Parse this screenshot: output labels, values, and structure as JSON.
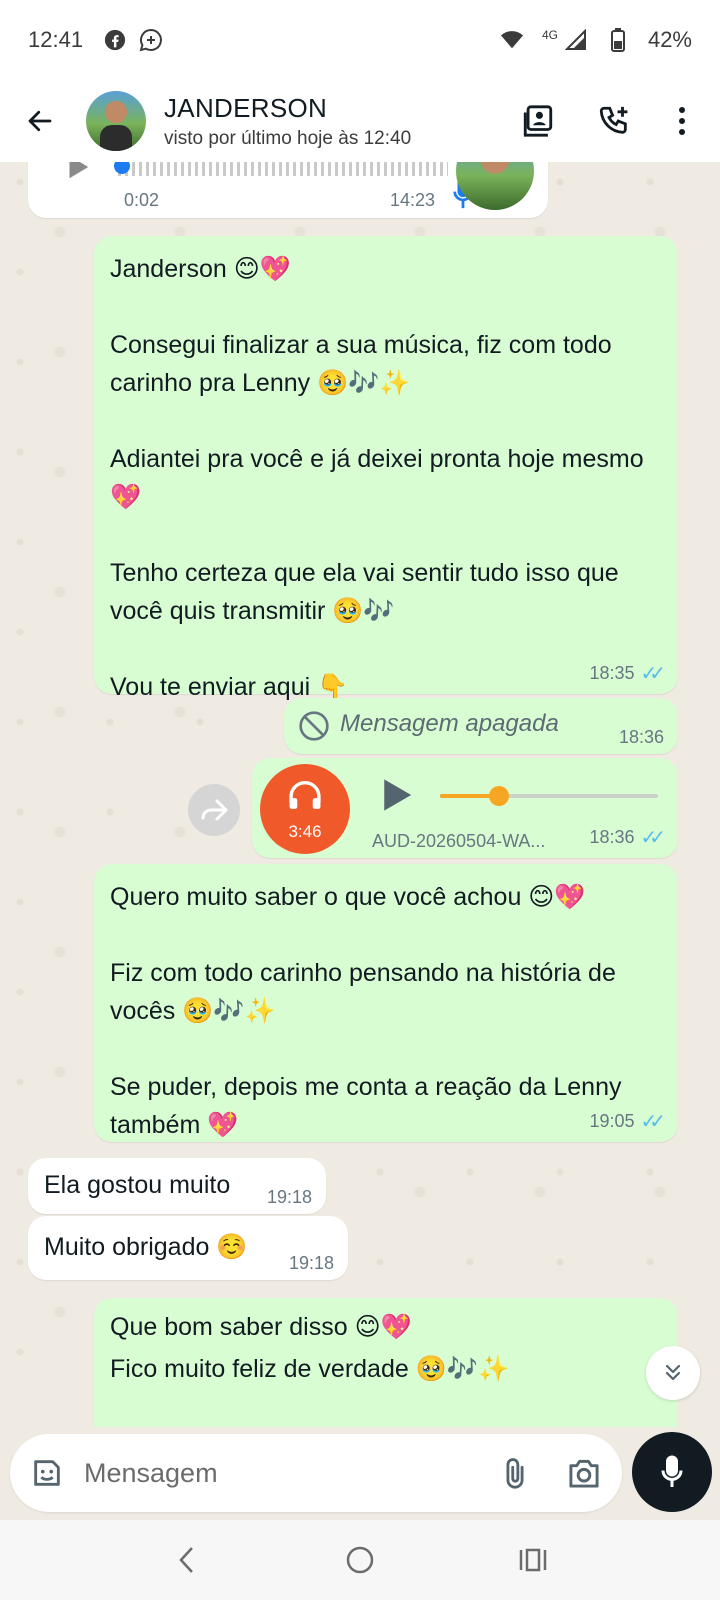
{
  "status_bar": {
    "time": "12:41",
    "network": "4G",
    "battery": "42%"
  },
  "header": {
    "contact_name": "JANDERSON",
    "status": "visto por último hoje às 12:40"
  },
  "messages": {
    "voice_prev": {
      "elapsed": "0:02",
      "time": "14:23"
    },
    "m1": {
      "text": "Janderson 😊💖\n\nConsegui finalizar a sua música, fiz com todo carinho pra Lenny 🥹🎶✨\n\nAdiantei pra você e já deixei pronta hoje mesmo 💖\n\nTenho certeza que ela vai sentir tudo isso que você quis transmitir 🥹🎶\n\nVou te enviar aqui 👇",
      "time": "18:35"
    },
    "deleted": {
      "text": "Mensagem apagada",
      "time": "18:36"
    },
    "audio": {
      "duration": "3:46",
      "filename": "AUD-20260504-WA...",
      "time": "18:36",
      "progress": 0.27
    },
    "m2": {
      "text": "Quero muito saber o que você achou 😊💖\n\nFiz com todo carinho pensando na história de vocês 🥹🎶✨\n\nSe puder, depois me conta a reação da Lenny também 💖",
      "time": "19:05"
    },
    "in1": {
      "text": "Ela gostou muito",
      "time": "19:18"
    },
    "in2": {
      "text": "Muito obrigado ☺️",
      "time": "19:18"
    },
    "m3": {
      "text": "Que bom saber disso 😊💖\nFico muito feliz de verdade 🥹🎶✨"
    }
  },
  "composer": {
    "placeholder": "Mensagem"
  },
  "colors": {
    "outgoing_bubble": "#d9fdd3",
    "incoming_bubble": "#ffffff",
    "read_tick": "#53bdeb",
    "audio_accent": "#f0592a",
    "progress": "#f5a623"
  }
}
